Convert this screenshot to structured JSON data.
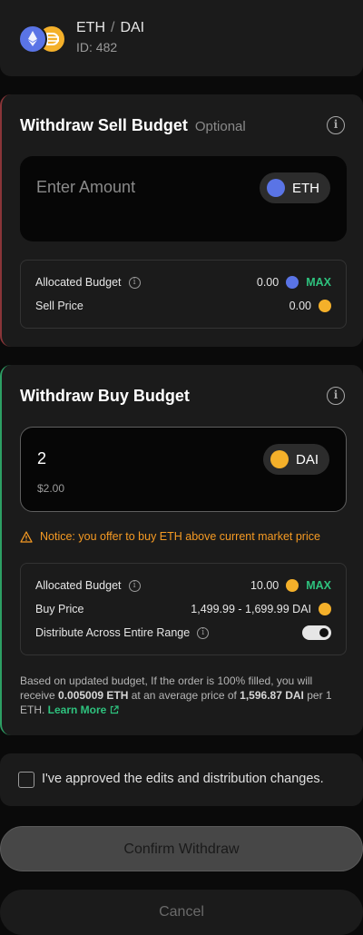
{
  "header": {
    "base_token": "ETH",
    "separator": "/",
    "quote_token": "DAI",
    "id_label": "ID: 482"
  },
  "sell": {
    "title": "Withdraw Sell Budget",
    "optional_label": "Optional",
    "placeholder": "Enter Amount",
    "token": "ETH",
    "allocated_label": "Allocated Budget",
    "allocated_value": "0.00",
    "max_label": "MAX",
    "price_label": "Sell Price",
    "price_value": "0.00"
  },
  "buy": {
    "title": "Withdraw Buy Budget",
    "amount": "2",
    "usd_value": "$2.00",
    "token": "DAI",
    "notice": "Notice: you offer to buy ETH above current market price",
    "allocated_label": "Allocated Budget",
    "allocated_value": "10.00",
    "max_label": "MAX",
    "price_label": "Buy Price",
    "price_value": "1,499.99 - 1,699.99 DAI",
    "distribute_label": "Distribute Across Entire Range",
    "distribute_on": true
  },
  "summary": {
    "text_1": "Based on updated budget, If the order is 100% filled, you will receive ",
    "eth_amount": "0.005009 ETH",
    "text_2": " at an average price of ",
    "avg_price": "1,596.87 DAI",
    "text_3": " per 1 ETH. ",
    "learn_more": "Learn More"
  },
  "approve": {
    "label": "I've approved the edits and distribution changes.",
    "checked": false
  },
  "buttons": {
    "confirm": "Confirm Withdraw",
    "cancel": "Cancel"
  },
  "colors": {
    "sell_accent": "#8a3538",
    "buy_accent": "#2d9f64",
    "max_green": "#2ec27e",
    "notice_orange": "#f59a23",
    "eth_blue": "#5a74e6",
    "dai_yellow": "#f4b02a"
  },
  "icons": [
    "eth-token-icon",
    "dai-token-icon",
    "info-icon",
    "warning-icon",
    "external-link-icon",
    "toggle-switch"
  ]
}
